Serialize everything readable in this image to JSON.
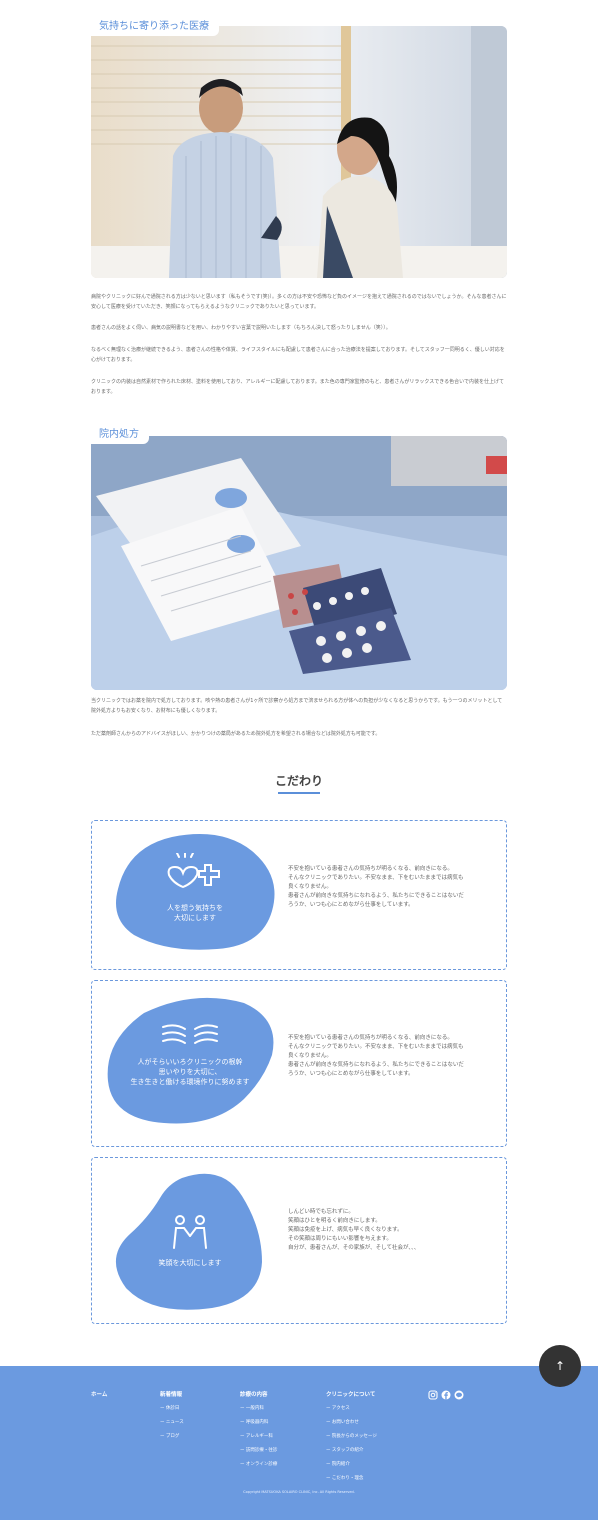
{
  "section1": {
    "tag": "気持ちに寄り添った医療",
    "paragraphs": [
      "病院やクリニックに好んで通院される方は少ないと思います（私もそうです(笑)）。多くの方は不安や恐怖など負のイメージを抱えて通院されるのではないでしょうか。そんな患者さんに安心して医療を受けていただき、笑顔になってもらえるようなクリニックでありたいと思っています。",
      "患者さんの話をよく伺い、病気の説明書などを用い、わかりやすい言葉で説明いたします（もちろん決して怒ったりしません（笑））。",
      "なるべく無理なく治療が継続できるよう、患者さんの性格や体質、ライフスタイルにも配慮して患者さんに合った治療法を提案しております。そしてスタッフ一同明るく、優しい対応を心がけております。",
      "クリニックの内装は自然素材で作られた床材、塗料を使用しており、アレルギーに配慮しております。また色の専門家監修のもと、患者さんがリラックスできる色合いで内装を仕上げております。"
    ]
  },
  "section2": {
    "tag": "院内処方",
    "paragraphs": [
      "当クリニックではお薬を院内で処方しております。咳や熱の患者さんが1ヶ所で診察から処方まで済ませられる方が体への負担が少なくなると思うからです。もう一つのメリットとして院外処方よりもお安くなり、お財布にも優しくなります。",
      "ただ薬剤師さんからのアドバイスがほしい、かかりつけの薬局があるため院外処方を希望される場合などは院外処方も可能です。"
    ]
  },
  "kodawari": {
    "title": "こだわり",
    "cards": [
      {
        "blob_text": [
          "人を想う気持ちを",
          "大切にします"
        ],
        "icon": "heart-plus-icon",
        "body": [
          "不安を抱いている患者さんの気持ちが明るくなる、前向きになる。",
          "そんなクリニックでありたい。不安なまま、下をむいたままでは病気も",
          "良くなりません。",
          "患者さんが前向きな気持ちになれるよう、私たちにできることはないだ",
          "ろうか、いつも心にとめながら仕事をしています。"
        ]
      },
      {
        "blob_text": [
          "人がそらいいろクリニックの根幹",
          "思いやりを大切に、",
          "生き生きと働ける環境作りに努めます"
        ],
        "icon": "hands-icon",
        "body": [
          "不安を抱いている患者さんの気持ちが明るくなる、前向きになる。",
          "そんなクリニックでありたい。不安なまま、下をむいたままでは病気も",
          "良くなりません。",
          "患者さんが前向きな気持ちになれるよう、私たちにできることはないだ",
          "ろうか、いつも心にとめながら仕事をしています。"
        ]
      },
      {
        "blob_text": [
          "笑顔を大切にします"
        ],
        "icon": "people-icon",
        "body": [
          "しんどい時でも忘れずに。",
          "笑顔はひとを明るく前向きにします。",
          "笑顔は免疫を上げ、病気も早く良くなります。",
          "その笑顔は周りにもいい影響を与えます。",
          "自分が、患者さんが、その家族が、そして社会が、、、"
        ]
      }
    ]
  },
  "backtop": {
    "icon": "arrow-up-icon",
    "label": "↑"
  },
  "footer": {
    "home": "ホーム",
    "columns": [
      {
        "head": "新着情報",
        "items": [
          "ー 休診日",
          "ー ニュース",
          "ー ブログ"
        ]
      },
      {
        "head": "診療の内容",
        "items": [
          "ー 一般内科",
          "ー 呼吸器内科",
          "ー アレルギー科",
          "ー 訪問診療・往診",
          "ー オンライン診療"
        ]
      },
      {
        "head": "クリニックについて",
        "items": [
          "ー アクセス",
          "ー お問い合わせ",
          "ー 院長からのメッセージ",
          "ー スタッフの紹介",
          "ー 院内紹介",
          "ー こだわり・理念"
        ]
      }
    ],
    "social": [
      "instagram-icon",
      "facebook-icon",
      "line-icon"
    ],
    "copyright": "Copyright MATSUOKA SOLAIRO CLINIC, Inc. All Rights Reserved."
  },
  "colors": {
    "accent": "#5b8fd9",
    "blob": "#6b9ae0",
    "footer": "#6b9ae0",
    "backtop": "#333333"
  }
}
